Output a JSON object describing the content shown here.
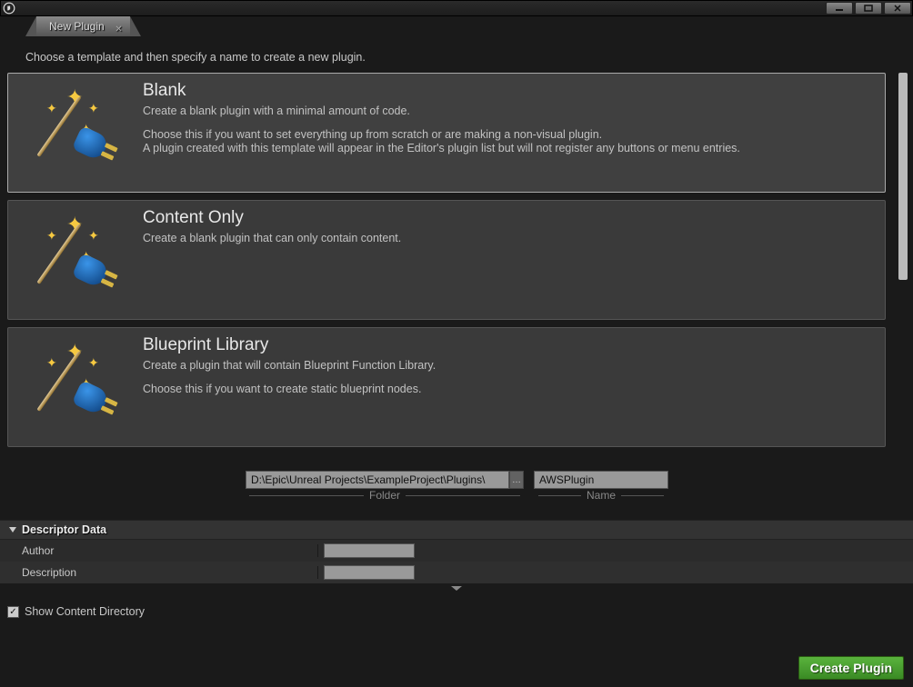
{
  "window": {
    "tab_title": "New Plugin"
  },
  "instruction": "Choose a template and then specify a name to create a new plugin.",
  "templates": [
    {
      "title": "Blank",
      "subtitle": "Create a blank plugin with a minimal amount of code.",
      "details": "Choose this if you want to set everything up from scratch or are making a non-visual plugin.\nA plugin created with this template will appear in the Editor's plugin list but will not register any buttons or menu entries.",
      "selected": true
    },
    {
      "title": "Content Only",
      "subtitle": "Create a blank plugin that can only contain content.",
      "details": "",
      "selected": false
    },
    {
      "title": "Blueprint Library",
      "subtitle": "Create a plugin that will contain Blueprint Function Library.",
      "details": "Choose this if you want to create static blueprint nodes.",
      "selected": false
    }
  ],
  "folder": {
    "label": "Folder",
    "value": "D:\\Epic\\Unreal Projects\\ExampleProject\\Plugins\\"
  },
  "name": {
    "label": "Name",
    "value": "AWSPlugin"
  },
  "descriptor": {
    "header": "Descriptor Data",
    "fields": {
      "author_label": "Author",
      "author_value": "",
      "description_label": "Description",
      "description_value": ""
    }
  },
  "footer": {
    "show_content_label": "Show Content Directory",
    "show_content_checked": true,
    "create_button": "Create Plugin"
  }
}
